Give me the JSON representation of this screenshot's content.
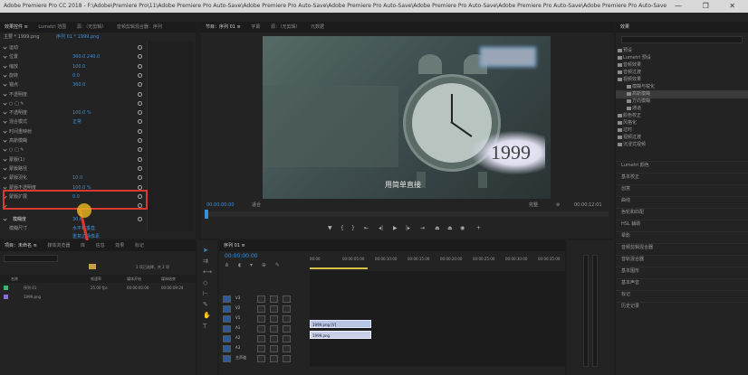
{
  "window": {
    "title": "Adobe Premiere Pro CC 2018 - F:\\Adobe\\Premiere Pro\\11\\Adobe Premiere Pro Auto-Save\\Adobe Premiere Pro Auto-Save\\Adobe Premiere Pro Auto-Save\\Adobe Premiere Pro Auto-Save\\Adobe Premiere Pro Auto-Save\\Adobe Premiere Pro Auto-Save",
    "controls": "— ❐ ✕"
  },
  "effect_controls": {
    "tabs": [
      "效果控件 ≡",
      "Lumetri 范围",
      "源：（无剪辑）",
      "音频剪辑混合器：序列"
    ],
    "source_label": "主要 * 1999.png",
    "sequence_label": "序列 01 * 1999.png",
    "props": [
      {
        "label": "运动",
        "value": ""
      },
      {
        "label": "位置",
        "value": "360.0  240.0"
      },
      {
        "label": "缩放",
        "value": "100.0"
      },
      {
        "label": "旋转",
        "value": "0.0"
      },
      {
        "label": "锚点",
        "value": "360.0"
      },
      {
        "label": "不透明度",
        "value": ""
      },
      {
        "label": "○ □ ✎",
        "value": ""
      },
      {
        "label": "不透明度",
        "value": "100.0 %"
      },
      {
        "label": "混合模式",
        "value": "正常"
      },
      {
        "label": "时间重映射",
        "value": ""
      },
      {
        "label": "高斯模糊",
        "value": ""
      },
      {
        "label": "○ □ ✎",
        "value": ""
      },
      {
        "label": "蒙版(1)",
        "value": ""
      },
      {
        "label": "蒙版路径",
        "value": ""
      },
      {
        "label": "蒙版羽化",
        "value": "10.0"
      },
      {
        "label": "蒙版不透明度",
        "value": "100.0 %"
      },
      {
        "label": "蒙版扩展",
        "value": "0.0"
      },
      {
        "label": "",
        "value": ""
      }
    ],
    "highlighted": {
      "label": "模糊度",
      "value": "30.0"
    },
    "after": [
      {
        "label": "模糊尺寸",
        "value": "水平和垂直"
      },
      {
        "label": "",
        "value": "重复边缘像素"
      }
    ],
    "bottom_label": "00:00:00:00",
    "timecode_footer": "00:00:00:00"
  },
  "program_monitor": {
    "tabs": [
      "节目：序列 01 ≡",
      "字幕",
      "源：（无剪辑）",
      "元数据"
    ],
    "watermark": "1999",
    "subtitle": "用简单直接",
    "timecode": "00:00:00:00",
    "fit": "适合",
    "quality": "完整",
    "duration": "00:00:12:01"
  },
  "project": {
    "tabs": [
      "项目：未命名 ≡",
      "媒体浏览器",
      "库",
      "信息",
      "效果",
      "标记"
    ],
    "search_placeholder": "",
    "count": "2 项已选择，共 2 项",
    "columns": [
      "名称",
      "帧速率",
      "媒体开始",
      "媒体结束"
    ],
    "items": [
      {
        "name": "序列 01",
        "fps": "25.00 fps",
        "start": "00:00:00:00",
        "end": "00:00:09:24"
      },
      {
        "name": "1999.png",
        "fps": "",
        "start": "",
        "end": ""
      }
    ]
  },
  "timeline": {
    "tab": "序列 01 ≡",
    "timecode": "00:00:00:00",
    "ruler": [
      "00:00",
      "00:00:05:00",
      "00:00:10:00",
      "00:00:15:00",
      "00:00:20:00",
      "00:00:25:00",
      "00:00:30:00",
      "00:00:35:00"
    ],
    "tracks": [
      "V3",
      "V2",
      "V1",
      "A1",
      "A2",
      "A3",
      "主声道"
    ],
    "clip_video": "1999.png [V]",
    "clip_audio": "1999.png",
    "master_value": "0.0"
  },
  "effects_panel": {
    "title": "效果",
    "items": [
      "预设",
      "Lumetri 预设",
      "音频效果",
      "音频过渡",
      "视频效果",
      "模糊与锐化",
      "高斯模糊",
      "方向模糊",
      "通道",
      "颜色校正",
      "风格化",
      "过时",
      "视频过渡",
      "沉浸式视频"
    ],
    "lower": [
      "Lumetri 颜色",
      "基本校正",
      "创意",
      "曲线",
      "色轮和匹配",
      "HSL 辅助",
      "晕影",
      "音频剪辑混合器",
      "音轨混合器",
      "基本图形",
      "基本声音",
      "标记",
      "历史记录"
    ]
  }
}
